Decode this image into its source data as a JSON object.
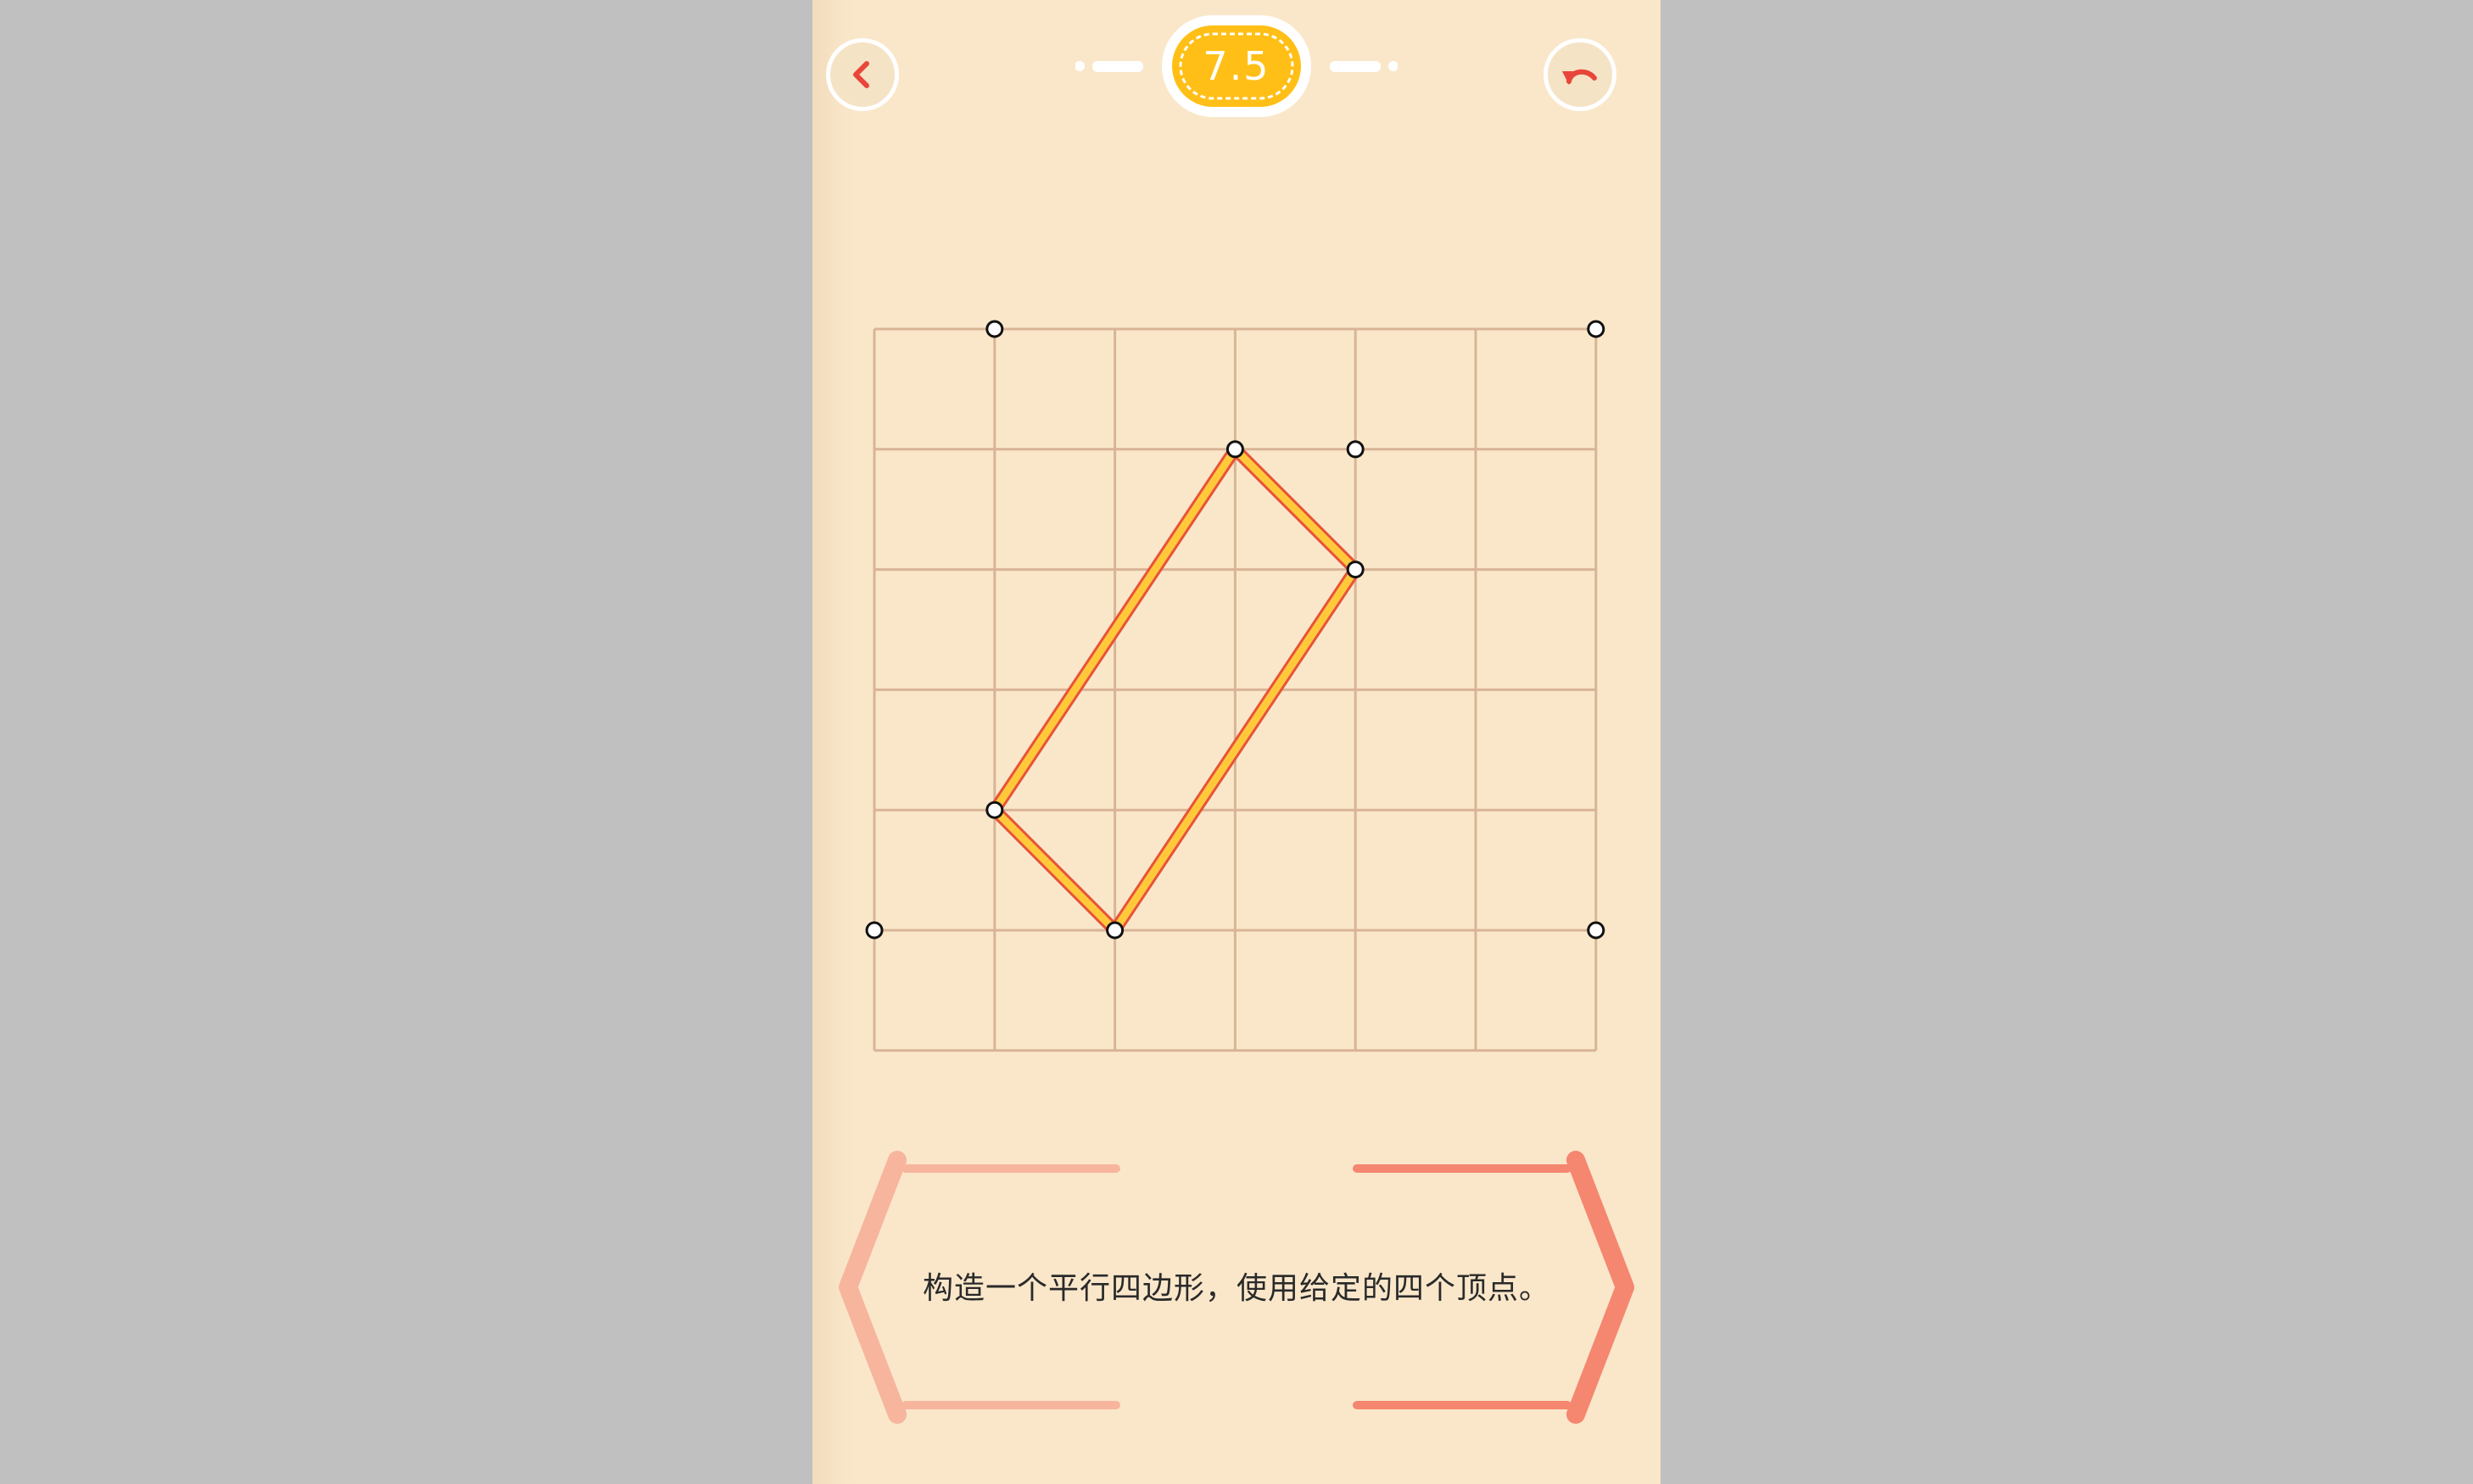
{
  "level": {
    "number": "7.5"
  },
  "buttons": {
    "back_icon": "chevron-left",
    "undo_icon": "undo-arrow"
  },
  "instruction": "构造一个平行四边形，使用给定的四个顶点。",
  "colors": {
    "background": "#fae7ca",
    "outer_background": "#c0c0c0",
    "grid_line": "#d9b496",
    "edge_fill": "#ffc93a",
    "edge_outline": "#e8523a",
    "badge": "#ffbf16",
    "icon_red": "#e8463a",
    "frame_left": "#f7b59e",
    "frame_right": "#f58670"
  },
  "board": {
    "columns": 6,
    "rows": 6,
    "points": [
      {
        "col": 1,
        "row": 0
      },
      {
        "col": 6,
        "row": 0
      },
      {
        "col": 3,
        "row": 1
      },
      {
        "col": 4,
        "row": 1
      },
      {
        "col": 4,
        "row": 2
      },
      {
        "col": 1,
        "row": 4
      },
      {
        "col": 0,
        "row": 5
      },
      {
        "col": 2,
        "row": 5
      },
      {
        "col": 6,
        "row": 5
      }
    ],
    "segments": [
      {
        "from": {
          "col": 3,
          "row": 1
        },
        "to": {
          "col": 4,
          "row": 2
        }
      },
      {
        "from": {
          "col": 4,
          "row": 2
        },
        "to": {
          "col": 2,
          "row": 5
        }
      },
      {
        "from": {
          "col": 2,
          "row": 5
        },
        "to": {
          "col": 1,
          "row": 4
        }
      },
      {
        "from": {
          "col": 1,
          "row": 4
        },
        "to": {
          "col": 3,
          "row": 1
        }
      }
    ]
  }
}
